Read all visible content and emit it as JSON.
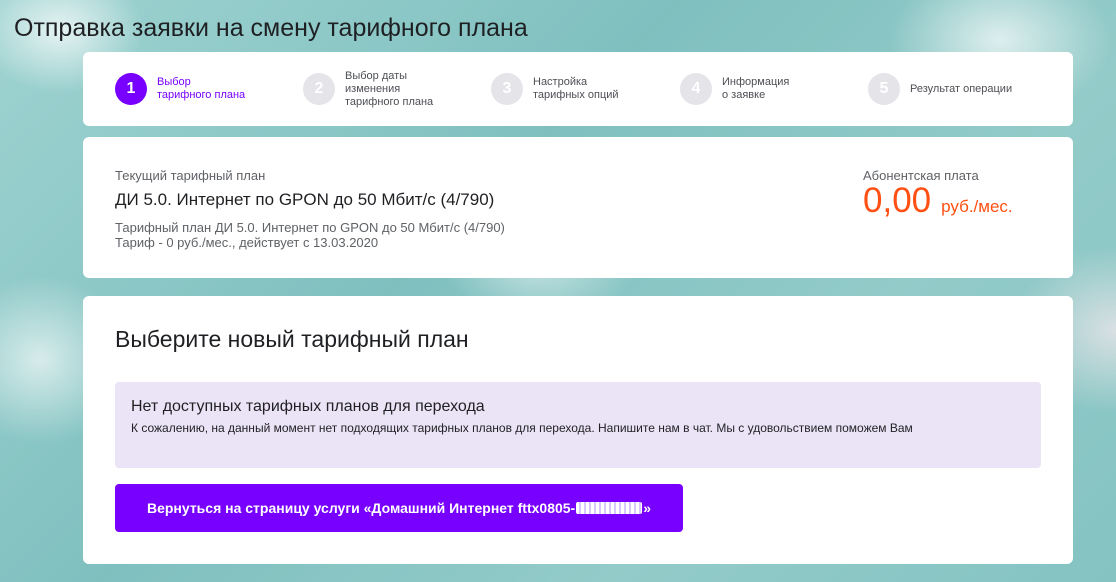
{
  "page": {
    "title": "Отправка заявки на смену тарифного плана"
  },
  "stepper": {
    "steps": [
      {
        "number": "1",
        "label": "Выбор\nтарифного плана",
        "active": true
      },
      {
        "number": "2",
        "label": "Выбор даты\nизменения\nтарифного плана",
        "active": false
      },
      {
        "number": "3",
        "label": "Настройка\nтарифных опций",
        "active": false
      },
      {
        "number": "4",
        "label": "Информация\nо заявке",
        "active": false
      },
      {
        "number": "5",
        "label": "Результат операции",
        "active": false
      }
    ]
  },
  "current_plan": {
    "caption": "Текущий тарифный план",
    "name": "ДИ 5.0. Интернет по GPON до 50 Мбит/с (4/790)",
    "description": "Тарифный план ДИ 5.0. Интернет по GPON до 50 Мбит/с (4/790)\nТариф - 0 руб./мес., действует с 13.03.2020",
    "fee_caption": "Абонентская плата",
    "fee_value": "0,00",
    "fee_unit": "руб./мес."
  },
  "choose": {
    "title": "Выберите новый тарифный план",
    "notice_title": "Нет доступных тарифных планов для перехода",
    "notice_text": "К сожалению, на данный момент нет подходящих тарифных планов для перехода. Напишите нам в чат. Мы с удовольствием поможем Вам",
    "back_button_prefix": "Вернуться на страницу услуги «Домашний Интернет fttx0805-",
    "back_button_suffix": "»"
  },
  "colors": {
    "accent": "#7700ff",
    "fee": "#ff4f12",
    "notice_bg": "#ebe3f6"
  }
}
